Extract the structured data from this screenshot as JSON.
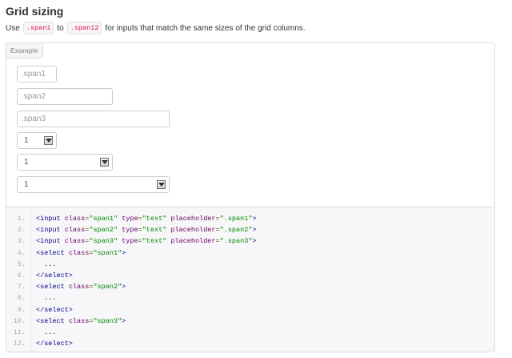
{
  "heading": "Grid sizing",
  "intro": {
    "pre": "Use",
    "code1": ".span1",
    "mid": "to",
    "code2": ".span12",
    "post": "for inputs that match the same sizes of the grid columns."
  },
  "example": {
    "tab_label": "Example",
    "inputs": [
      {
        "placeholder": ".span1"
      },
      {
        "placeholder": ".span2"
      },
      {
        "placeholder": ".span3"
      }
    ],
    "selects": [
      {
        "value": "1"
      },
      {
        "value": "1"
      },
      {
        "value": "1"
      }
    ]
  },
  "code": {
    "line_numbers": [
      "1.",
      "2.",
      "3.",
      "4.",
      "5.",
      "6.",
      "7.",
      "8.",
      "9.",
      "10.",
      "11.",
      "12."
    ],
    "lines": [
      [
        {
          "t": "<input ",
          "c": "tag"
        },
        {
          "t": "class",
          "c": "atn"
        },
        {
          "t": "=",
          "c": "pun"
        },
        {
          "t": "\"span1\"",
          "c": "atv"
        },
        {
          "t": " type",
          "c": "atn"
        },
        {
          "t": "=",
          "c": "pun"
        },
        {
          "t": "\"text\"",
          "c": "atv"
        },
        {
          "t": " placeholder",
          "c": "atn"
        },
        {
          "t": "=",
          "c": "pun"
        },
        {
          "t": "\".span1\"",
          "c": "atv"
        },
        {
          "t": ">",
          "c": "tag"
        }
      ],
      [
        {
          "t": "<input ",
          "c": "tag"
        },
        {
          "t": "class",
          "c": "atn"
        },
        {
          "t": "=",
          "c": "pun"
        },
        {
          "t": "\"span2\"",
          "c": "atv"
        },
        {
          "t": " type",
          "c": "atn"
        },
        {
          "t": "=",
          "c": "pun"
        },
        {
          "t": "\"text\"",
          "c": "atv"
        },
        {
          "t": " placeholder",
          "c": "atn"
        },
        {
          "t": "=",
          "c": "pun"
        },
        {
          "t": "\".span2\"",
          "c": "atv"
        },
        {
          "t": ">",
          "c": "tag"
        }
      ],
      [
        {
          "t": "<input ",
          "c": "tag"
        },
        {
          "t": "class",
          "c": "atn"
        },
        {
          "t": "=",
          "c": "pun"
        },
        {
          "t": "\"span3\"",
          "c": "atv"
        },
        {
          "t": " type",
          "c": "atn"
        },
        {
          "t": "=",
          "c": "pun"
        },
        {
          "t": "\"text\"",
          "c": "atv"
        },
        {
          "t": " placeholder",
          "c": "atn"
        },
        {
          "t": "=",
          "c": "pun"
        },
        {
          "t": "\".span3\"",
          "c": "atv"
        },
        {
          "t": ">",
          "c": "tag"
        }
      ],
      [
        {
          "t": "<select ",
          "c": "tag"
        },
        {
          "t": "class",
          "c": "atn"
        },
        {
          "t": "=",
          "c": "pun"
        },
        {
          "t": "\"span1\"",
          "c": "atv"
        },
        {
          "t": ">",
          "c": "tag"
        }
      ],
      [
        {
          "t": "  ...",
          "c": "pln"
        }
      ],
      [
        {
          "t": "</select>",
          "c": "tag"
        }
      ],
      [
        {
          "t": "<select ",
          "c": "tag"
        },
        {
          "t": "class",
          "c": "atn"
        },
        {
          "t": "=",
          "c": "pun"
        },
        {
          "t": "\"span2\"",
          "c": "atv"
        },
        {
          "t": ">",
          "c": "tag"
        }
      ],
      [
        {
          "t": "  ...",
          "c": "pln"
        }
      ],
      [
        {
          "t": "</select>",
          "c": "tag"
        }
      ],
      [
        {
          "t": "<select ",
          "c": "tag"
        },
        {
          "t": "class",
          "c": "atn"
        },
        {
          "t": "=",
          "c": "pun"
        },
        {
          "t": "\"span3\"",
          "c": "atv"
        },
        {
          "t": ">",
          "c": "tag"
        }
      ],
      [
        {
          "t": "  ...",
          "c": "pln"
        }
      ],
      [
        {
          "t": "</select>",
          "c": "tag"
        }
      ]
    ]
  },
  "colors": {
    "code_tag": "#000088",
    "code_attr": "#660066",
    "code_value": "#008800",
    "inline_code": "#dd1144"
  }
}
